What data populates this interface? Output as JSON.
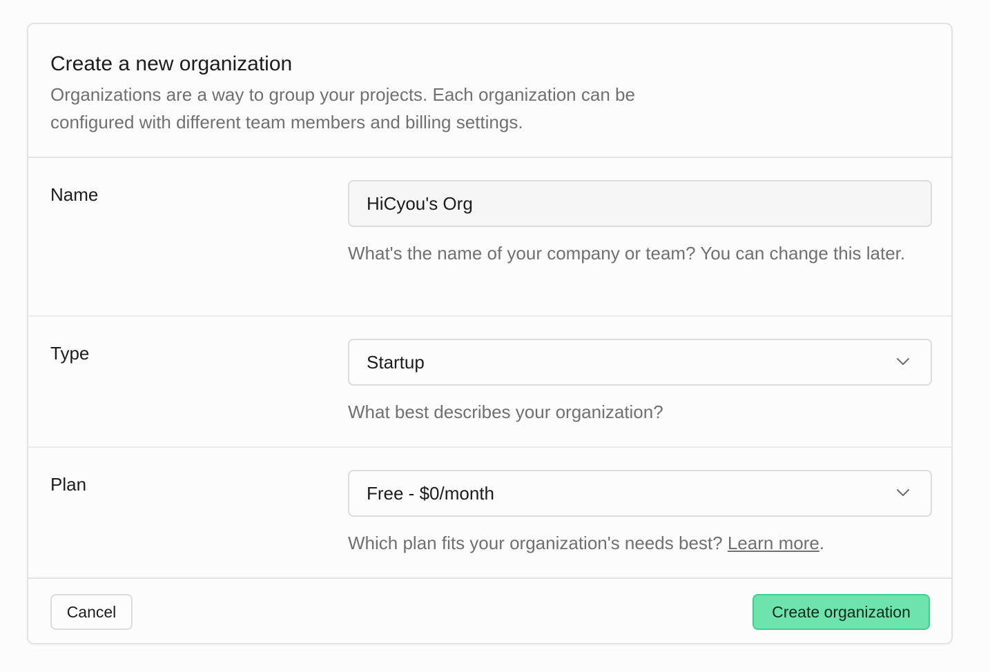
{
  "header": {
    "title": "Create a new organization",
    "description": "Organizations are a way to group your projects. Each organization can be configured with different team members and billing settings."
  },
  "form": {
    "name": {
      "label": "Name",
      "value": "HiCyou's Org",
      "help": "What's the name of your company or team? You can change this later."
    },
    "type": {
      "label": "Type",
      "selected": "Startup",
      "help": "What best describes your organization?"
    },
    "plan": {
      "label": "Plan",
      "selected": "Free - $0/month",
      "help": "Which plan fits your organization's needs best?",
      "link": "Learn more",
      "help_suffix": "."
    }
  },
  "footer": {
    "cancel_label": "Cancel",
    "create_label": "Create organization"
  },
  "colors": {
    "accent": "#3ecf8e",
    "accent_fill": "#6ee3ae"
  }
}
